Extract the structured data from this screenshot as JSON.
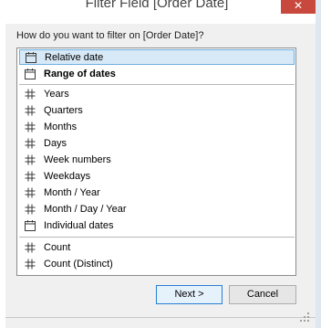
{
  "window": {
    "title": "Filter Field [Order Date]",
    "close_glyph": "✕"
  },
  "prompt": "How do you want to filter on [Order Date]?",
  "list": {
    "items": [
      {
        "label": "Relative date",
        "icon": "calendar-icon",
        "selected": true
      },
      {
        "label": "Range of dates",
        "icon": "calendar-icon",
        "bold": true
      },
      {
        "label": "Years",
        "icon": "hash-icon"
      },
      {
        "label": "Quarters",
        "icon": "hash-icon"
      },
      {
        "label": "Months",
        "icon": "hash-icon"
      },
      {
        "label": "Days",
        "icon": "hash-icon"
      },
      {
        "label": "Week numbers",
        "icon": "hash-icon"
      },
      {
        "label": "Weekdays",
        "icon": "hash-icon"
      },
      {
        "label": "Month / Year",
        "icon": "hash-icon"
      },
      {
        "label": "Month / Day / Year",
        "icon": "hash-icon"
      },
      {
        "label": "Individual dates",
        "icon": "calendar-icon"
      },
      {
        "label": "Count",
        "icon": "hash-icon"
      },
      {
        "label": "Count (Distinct)",
        "icon": "hash-icon"
      }
    ]
  },
  "buttons": {
    "next": "Next >",
    "cancel": "Cancel"
  },
  "colors": {
    "selection_fill": "#d7e9f7",
    "selection_border": "#6fb0e0",
    "icon": "#3a3a3a",
    "close_button": "#c9483e"
  }
}
